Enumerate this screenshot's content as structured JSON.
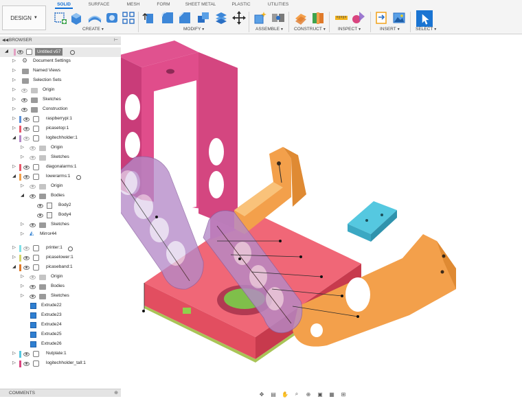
{
  "toolbar": {
    "design_label": "DESIGN",
    "tabs": [
      "SOLID",
      "SURFACE",
      "MESH",
      "FORM",
      "SHEET METAL",
      "PLASTIC",
      "UTILITIES"
    ],
    "active_tab": "SOLID",
    "groups": [
      "CREATE",
      "MODIFY",
      "ASSEMBLE",
      "CONSTRUCT",
      "INSPECT",
      "INSERT",
      "SELECT"
    ]
  },
  "browser": {
    "title": "BROWSER",
    "items": [
      {
        "label": "Untitled v57"
      },
      {
        "label": "Document Settings"
      },
      {
        "label": "Named Views"
      },
      {
        "label": "Selection Sets"
      },
      {
        "label": "Origin"
      },
      {
        "label": "Sketches"
      },
      {
        "label": "Construction"
      },
      {
        "label": "raspberrypi:1"
      },
      {
        "label": "picasetop:1"
      },
      {
        "label": "logitechholder:1"
      },
      {
        "label": "Origin"
      },
      {
        "label": "Sketches"
      },
      {
        "label": "diagonalarms:1"
      },
      {
        "label": "lowerarms:1"
      },
      {
        "label": "Origin"
      },
      {
        "label": "Bodies"
      },
      {
        "label": "Body2"
      },
      {
        "label": "Body4"
      },
      {
        "label": "Sketches"
      },
      {
        "label": "Mirror44"
      },
      {
        "label": "printer:1"
      },
      {
        "label": "picaselower:1"
      },
      {
        "label": "picaseband:1"
      },
      {
        "label": "Origin"
      },
      {
        "label": "Bodies"
      },
      {
        "label": "Sketches"
      },
      {
        "label": "Extrude22"
      },
      {
        "label": "Extrude23"
      },
      {
        "label": "Extrude24"
      },
      {
        "label": "Extrude25"
      },
      {
        "label": "Extrude26"
      },
      {
        "label": "Nutplate:1"
      },
      {
        "label": "logitechholder_tall:1"
      }
    ]
  },
  "comments": {
    "title": "COMMENTS"
  },
  "colors": {
    "accent": "#0d6dd6",
    "magenta_part": "#d9457f",
    "orange_part": "#f3a04b",
    "red_part": "#e8586a",
    "cyan_part": "#55c8e0",
    "lavender_arms": "#b58ac8"
  },
  "icons": {
    "nav_bar": [
      "orbit-icon",
      "look-at-icon",
      "pan-icon",
      "zoom-icon",
      "fit-icon",
      "display-settings-icon",
      "grid-icon",
      "viewports-icon"
    ]
  }
}
